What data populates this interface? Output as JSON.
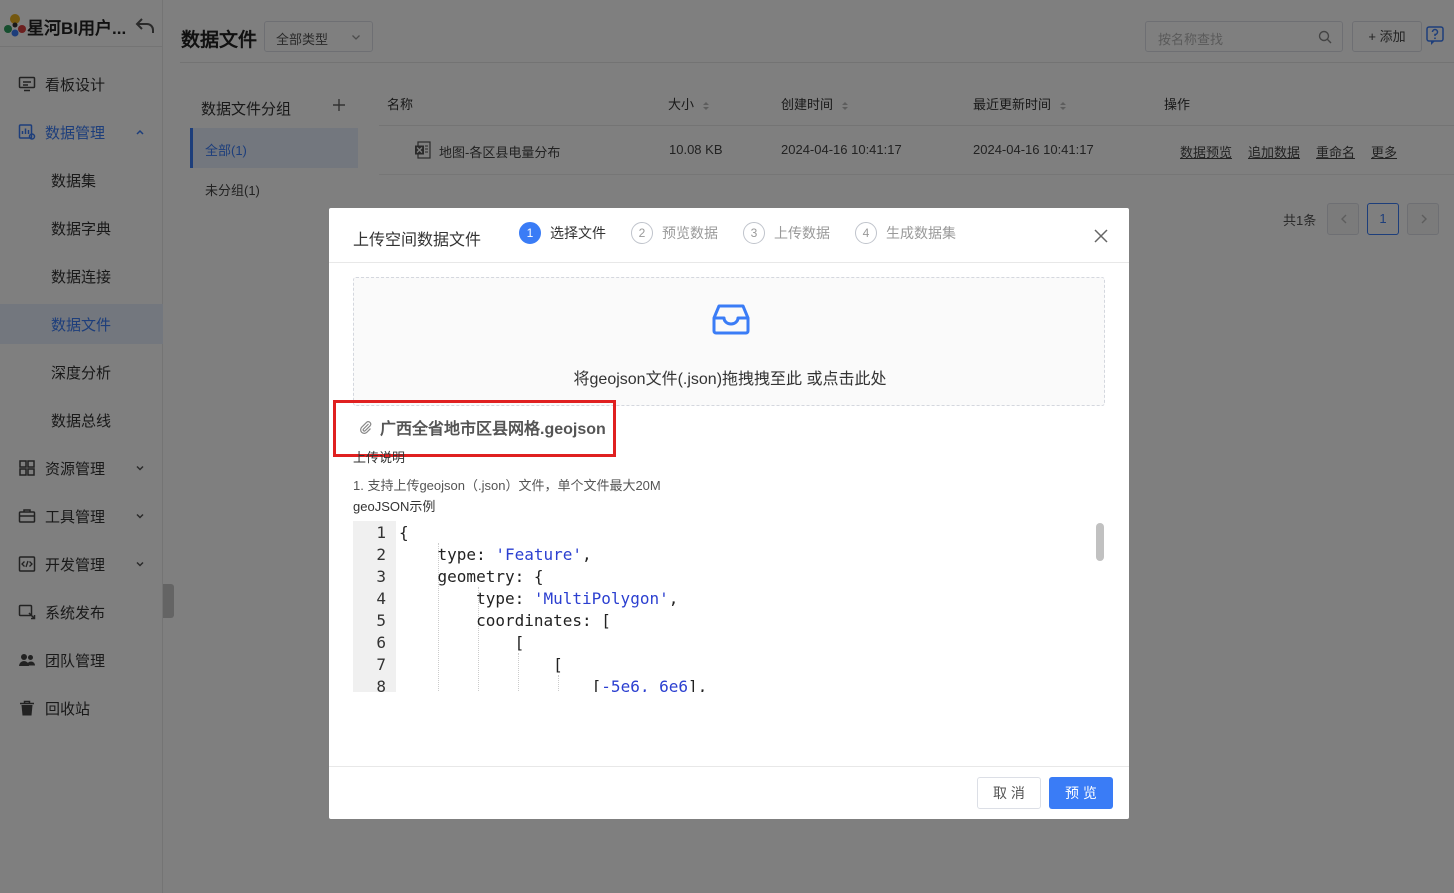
{
  "app": {
    "title": "星河BI用户..."
  },
  "sidebar": {
    "items": [
      {
        "label": "看板设计",
        "icon": "monitor-icon"
      },
      {
        "label": "数据管理",
        "icon": "data-icon"
      },
      {
        "label": "资源管理",
        "icon": "resource-icon"
      },
      {
        "label": "工具管理",
        "icon": "toolbox-icon"
      },
      {
        "label": "开发管理",
        "icon": "code-icon"
      },
      {
        "label": "系统发布",
        "icon": "publish-icon"
      },
      {
        "label": "团队管理",
        "icon": "team-icon"
      },
      {
        "label": "回收站",
        "icon": "trash-icon"
      }
    ],
    "sub_items": [
      {
        "label": "数据集"
      },
      {
        "label": "数据字典"
      },
      {
        "label": "数据连接"
      },
      {
        "label": "数据文件"
      },
      {
        "label": "深度分析"
      },
      {
        "label": "数据总线"
      }
    ]
  },
  "header": {
    "title": "数据文件",
    "type_select": "全部类型",
    "search_placeholder": "按名称查找",
    "add_label": "+ 添加"
  },
  "groups": {
    "title": "数据文件分组",
    "items": [
      {
        "label": "全部(1)"
      },
      {
        "label": "未分组(1)"
      }
    ]
  },
  "table": {
    "columns": {
      "name": "名称",
      "size": "大小",
      "created": "创建时间",
      "updated": "最近更新时间",
      "ops": "操作"
    },
    "rows": [
      {
        "name": "地图-各区县电量分布",
        "size": "10.08 KB",
        "created": "2024-04-16 10:41:17",
        "updated": "2024-04-16 10:41:17"
      }
    ],
    "ops": {
      "preview": "数据预览",
      "append": "追加数据",
      "rename": "重命名",
      "more": "更多"
    },
    "pagination": {
      "total": "共1条",
      "page": "1"
    }
  },
  "modal": {
    "title": "上传空间数据文件",
    "steps": [
      {
        "num": "1",
        "label": "选择文件"
      },
      {
        "num": "2",
        "label": "预览数据"
      },
      {
        "num": "3",
        "label": "上传数据"
      },
      {
        "num": "4",
        "label": "生成数据集"
      }
    ],
    "dropzone_text": "将geojson文件(.json)拖拽拽至此 或点击此处",
    "file_name": "广西全省地市区县网格.geojson",
    "upload_note_title": "上传说明",
    "note_line1": "1. 支持上传geojson（.json）文件，单个文件最大20M",
    "note_line2": "geoJSON示例",
    "code": {
      "line_numbers": [
        "1",
        "2",
        "3",
        "4",
        "5",
        "6",
        "7",
        "8"
      ],
      "l1": "{",
      "l2_key": "    type: ",
      "l2_str": "'Feature'",
      "l2_end": ",",
      "l3": "    geometry: {",
      "l4_key": "        type: ",
      "l4_str": "'MultiPolygon'",
      "l4_end": ",",
      "l5": "        coordinates: [",
      "l6": "            [",
      "l7": "                [",
      "l8_pre": "                    [",
      "l8_str": "-5e6, 6e6",
      "l8_end": "],"
    },
    "cancel_label": "取 消",
    "preview_label": "预 览"
  },
  "colors": {
    "accent": "#3a7cf6",
    "highlight": "#e02020"
  }
}
